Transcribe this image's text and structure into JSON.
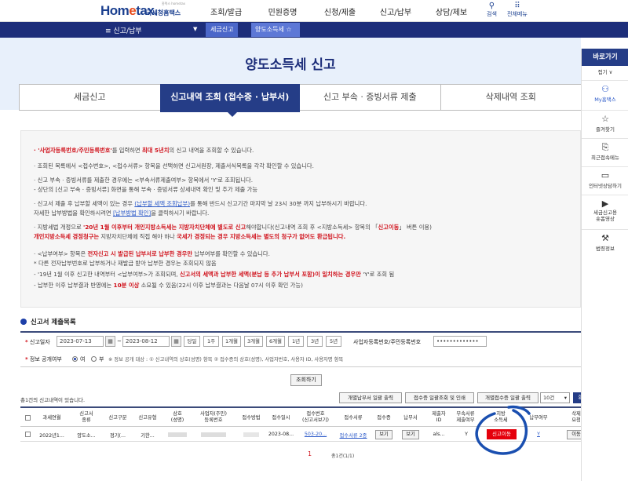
{
  "header": {
    "logo_main_a": "Hom",
    "logo_main_o": "e",
    "logo_main_b": "tax.",
    "logo_sub": "국세청홈택스",
    "logo_small": "홈택스 hometax",
    "nav": [
      "조회/발급",
      "민원증명",
      "신청/제출",
      "신고/납부",
      "상담/제보"
    ],
    "search_label": "검색",
    "menu_label": "전체메뉴"
  },
  "breadcrumb": {
    "home": "≡  신고/납부",
    "level2": "세금신고",
    "level3": "양도소득세 ☆"
  },
  "page": {
    "title": "양도소득세 신고"
  },
  "tabs": [
    {
      "label": "세금신고",
      "active": false
    },
    {
      "label": "신고내역 조회 (접수증 · 납부서)",
      "active": true
    },
    {
      "label": "신고 부속 · 증빙서류 제출",
      "active": false
    },
    {
      "label": "삭제내역 조회",
      "active": false
    }
  ],
  "info": {
    "l1_a": "· '사업자등록번호/주민등록번호'",
    "l1_b": "를 입력하면 ",
    "l1_c": "최대 5년치",
    "l1_d": "의 신고 내역을 조회할 수 있습니다.",
    "l2": "· 조회된 목록에서 <접수번호>, <접수서류> 항목을 선택하면 신고서원장, 제출서식목록을 각각 확인할 수 있습니다.",
    "l3": "· 신고 부속 · 증빙서류를 제출한 경우에는 <부속서류제출여부> 항목에서 'Y'로 조회됩니다.",
    "l4": "  - 상단의 [신고 부속 · 증빙서류] 화면을 통해 부속 · 증빙서류 상세내역 확인 및 추가 제출 가능",
    "l5_a": "· 신고서 제출 후 납부할 세액이 있는 경우 ",
    "l5_b": "(납부할 세액 조회납부)",
    "l5_c": "를 통해 반드시 신고기간 마지막 날 23시 30분 까지 납부하시기 바랍니다.",
    "l6_a": "  자세한 납부방법을 확인하시려면 ",
    "l6_b": "[납부방법 확인]",
    "l6_c": "을 클릭하시기 바랍니다.",
    "l7_a": "· 지방세법 개정으로 ",
    "l7_b": "'20년 1월 이후부터 개인지방소득세는 지방자치단체에 별도로 신고",
    "l7_c": "해야합니다(신고내역 조회 후 <지방소득세> 항목의 「",
    "l7_d": "신고이동",
    "l7_e": "」 버튼 이용)",
    "l8_a": "  개인지방소득세 경정청구는",
    "l8_b": " 지방자치단체에 직접 해야 하나 ",
    "l8_c": "국세가 경정되는 경우 지방소득세는 별도의 청구가 없어도 환급됩니다.",
    "l9_a": "· <납부여부> 항목은 ",
    "l9_b": "전자신고 시 발급된 납부서로 납부한 경우만",
    "l9_c": " 납부여부를 확인할 수 있습니다.",
    "l10": "   * 다른 전자납부번호로 납부하거나 재발급 받아 납부한 경우는 조회되지 않음",
    "l11_a": "  - '19년 1월 이후 신고한 내역부터 <납부여부>가 조회되며, ",
    "l11_b": "신고서의 세액과 납부한 세액(분납 등 추가 납부서 포함)이 일치하는 경우만",
    "l11_c": " 'Y'로 조회 됨",
    "l12_a": "  - 납부한 이후 납부결과 반영에는 ",
    "l12_b": "10분 이상",
    "l12_c": " 소요될 수 있음(22시 이후 납부결과는 다음날 07시 이후 확인 가능)"
  },
  "search": {
    "section_title": "신고서 제출목록",
    "date_label": "신고일자",
    "date_from": "2023-07-13",
    "date_to": "2023-08-12",
    "periods": [
      "당일",
      "1주",
      "1개월",
      "3개월",
      "6개월",
      "1년",
      "3년",
      "5년"
    ],
    "id_label": "사업자등록번호/주민등록번호",
    "id_value": "•••••••••••••",
    "disclose_label": "정보 공개여부",
    "opt_yes": "여",
    "opt_no": "부",
    "disclose_note": "※ 정보 공개 대상 : ① 신고내역의 상호(성명) 항목 ② 접수증의 상호(성명), 사업자번호, 사용자 ID, 사용자명 항목",
    "query_button": "조회하기"
  },
  "result": {
    "count_text": "총1건의 신고내역이 있습니다.",
    "btn_bulk_pay": "개별납부서 일괄 출력",
    "btn_receipt": "접수증 일괄조회 및 인쇄",
    "btn_bulk_receipt": "개별접수증 일괄 출력",
    "page_size": "10건",
    "confirm": "확인",
    "columns": [
      "과세연월",
      "신고서\n종류",
      "신고구분",
      "신고유형",
      "상호\n(성명)",
      "사업자(주민)\n등록번호",
      "접수방법",
      "접수일시",
      "접수번호\n(신고서보기)",
      "접수서류",
      "접수증",
      "납부서",
      "제출자\nID",
      "부속서류\n제출여부",
      "지방\n소득세",
      "납부여부",
      "삭제\n요청"
    ],
    "rows": [
      {
        "period": "2022년1...",
        "type": "양도소...",
        "kind": "정기(...",
        "form": "기한...",
        "name": "",
        "reg_no": "",
        "method": "",
        "received": "2023-08...",
        "receipt_no": "503-20...",
        "docs": "접수서류 2종",
        "receipt_btn": "보기",
        "bill_btn": "보기",
        "submitter": "als...",
        "attached": "Y",
        "local_tax_btn": "신고이동",
        "paid": "Y",
        "delete_btn": "이동"
      }
    ],
    "page_current": "1",
    "page_count": "총1건(1/1)"
  },
  "sidebar": {
    "title": "바로가기",
    "fold": "접기 ∨",
    "items": [
      {
        "label": "My홈택스",
        "icon": "person-icon"
      },
      {
        "label": "즐겨찾기",
        "icon": "star-icon"
      },
      {
        "label": "최근접속메뉴",
        "icon": "recent-icon"
      },
      {
        "label": "인터넷상담하기",
        "icon": "monitor-icon"
      },
      {
        "label": "세금신고용\n숏폼영상",
        "icon": "play-icon"
      },
      {
        "label": "법령정보",
        "icon": "gavel-icon"
      }
    ]
  },
  "colors": {
    "navy": "#1d2e7a",
    "tab_active": "#253d87",
    "band": "#e8f0fb",
    "accent_red": "#e5000c",
    "annotation_blue": "#1a4fb0"
  }
}
